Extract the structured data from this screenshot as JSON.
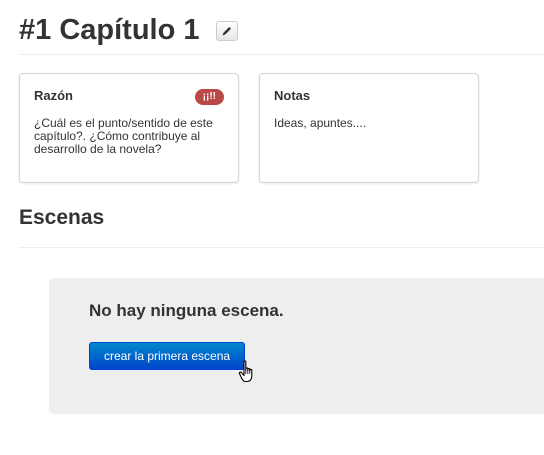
{
  "chapter": {
    "title": "#1 Capítulo 1",
    "edit_icon": "pencil-icon"
  },
  "cards": [
    {
      "title": "Razón",
      "badge": "¡¡!!",
      "badge_color": "#b94a48",
      "body": "¿Cuál es el punto/sentido de este capítulo?. ¿Cómo contribuye al desarrollo de la novela?"
    },
    {
      "title": "Notas",
      "body": "Ideas, apuntes...."
    }
  ],
  "scenes": {
    "title": "Escenas",
    "empty_message": "No hay ninguna escena.",
    "create_button": "crear la primera escena",
    "button_color": "#0055cc"
  },
  "cursor_icon": "hand-pointer-icon"
}
